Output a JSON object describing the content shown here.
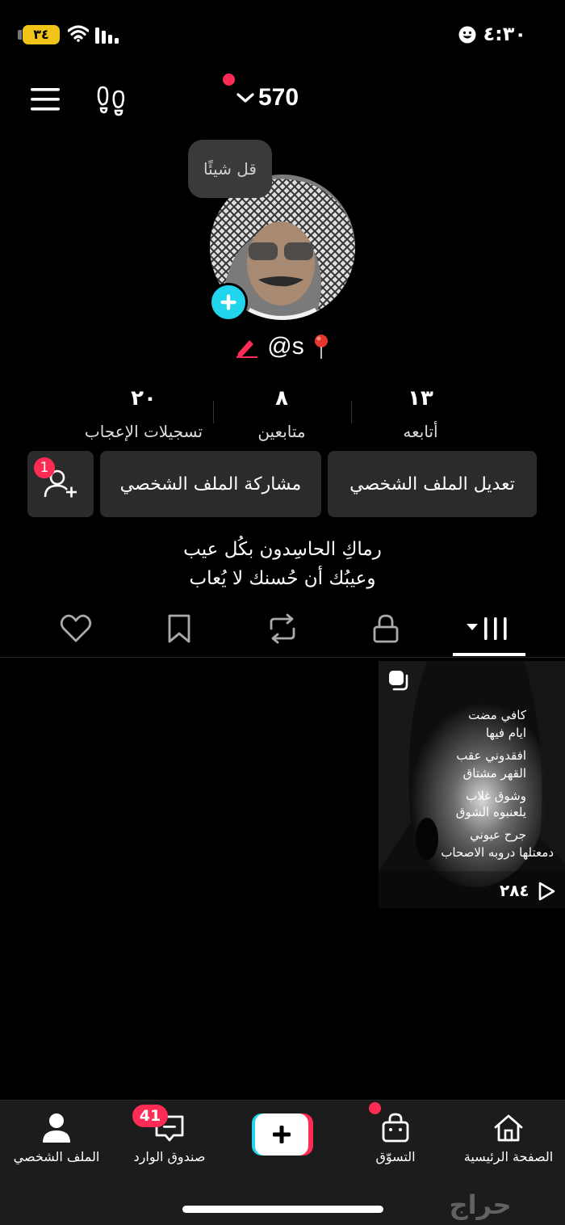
{
  "status_bar": {
    "battery": "٣٤",
    "time": "٤:٣٠"
  },
  "header": {
    "count": "570"
  },
  "profile": {
    "say_something": "قل شيئًا",
    "username": "@s",
    "stats": {
      "following_count": "١٣",
      "following_label": "أتابعه",
      "followers_count": "٨",
      "followers_label": "متابعين",
      "likes_count": "٢٠",
      "likes_label": "تسجيلات الإعجاب"
    },
    "buttons": {
      "edit_profile": "تعديل الملف الشخصي",
      "share_profile": "مشاركة الملف الشخصي",
      "add_friends_badge": "1"
    },
    "bio": {
      "line1": "رماكِ الحاسِدون بكُل عيب",
      "line2": "وعيبُك أن حُسنك لا يُعاب"
    }
  },
  "tabs": [
    "videos",
    "private",
    "reposts",
    "favorites",
    "liked"
  ],
  "videos": [
    {
      "text_lines": [
        "كافي مضت",
        "ايام فيها",
        "افقدوني عقب",
        "القهر مشتاق",
        "وشوق غلاب",
        "يلعنبوه الشوق",
        "جرح عيوني",
        "دمعتلها دروبه الاصحاب"
      ],
      "play_count": "٢٨٤"
    }
  ],
  "bottom_nav": {
    "home": "الصفحة الرئيسية",
    "shop": "التسوّق",
    "create": "+",
    "inbox": "صندوق الوارد",
    "inbox_badge": "41",
    "profile": "الملف الشخصي"
  },
  "watermark": "حراج",
  "colors": {
    "accent": "#fe2c55",
    "cyan": "#20d5ec",
    "button_bg": "#2b2b2b",
    "nav_bg": "#1c1c1c"
  }
}
